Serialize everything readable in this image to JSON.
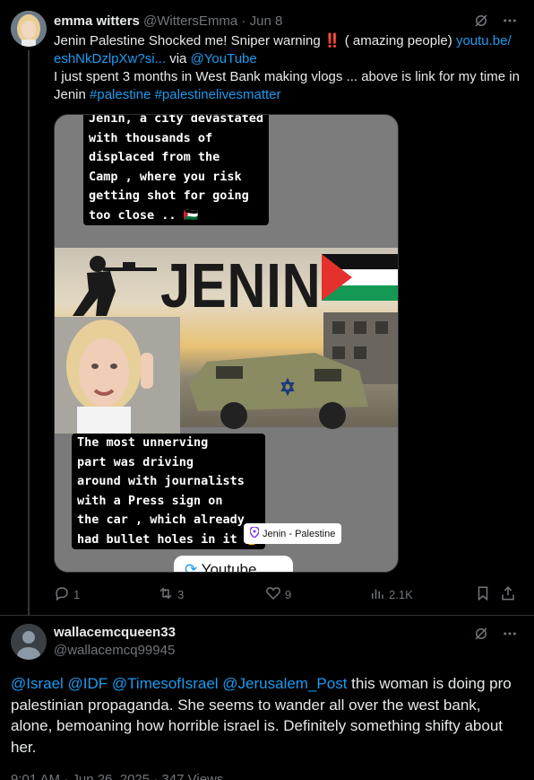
{
  "tweet1": {
    "name": "emma witters",
    "handle": "@WittersEmma",
    "separator": "·",
    "date": "Jun 8",
    "text_part1": "Jenin Palestine Shocked me! Sniper warning ",
    "bangs": "‼️",
    "text_part2": " ( amazing people) ",
    "link1": "youtu.be/",
    "link2": "eshNkDzlpXw?si...",
    "via": " via ",
    "via_handle": "@YouTube",
    "line2": "I just spent 3 months in West Bank making vlogs ... above is link for my time in Jenin ",
    "hashtag1": "#palestine",
    "hashtag2": "#palestinelivesmatter",
    "media": {
      "caption_top": "Jenin, a city devastated\nwith thousands of\ndisplaced from the\nCamp , where you risk\ngetting shot for going\ntoo close .. 🇵🇸",
      "banner_word": "JENIN",
      "caption_bottom": "The most unnerving\npart was driving\naround with journalists\nwith a Press sign on\nthe car , which already\nhad bullet holes in it 😳",
      "location": "Jenin - Palestine",
      "youtube_label": "Youtube"
    },
    "actions": {
      "replies": "1",
      "reposts": "3",
      "likes": "9",
      "views": "2.1K"
    }
  },
  "tweet2": {
    "name": "wallacemcqueen33",
    "handle": "@wallacemcq99945",
    "mentions": "@Israel @IDF @TimesofIsrael @Jerusalem_Post",
    "text": " this woman is doing pro palestinian propaganda. She seems to wander all over the west bank, alone, bemoaning how horrible israel is.  Definitely something shifty about her.",
    "meta": "9:01 AM · Jun 26, 2025 · 347 Views"
  },
  "colors": {
    "background": "#000000",
    "text": "#e7e9ea",
    "muted": "#71767b",
    "link": "#1d9bf0",
    "divider": "#2f3336"
  }
}
